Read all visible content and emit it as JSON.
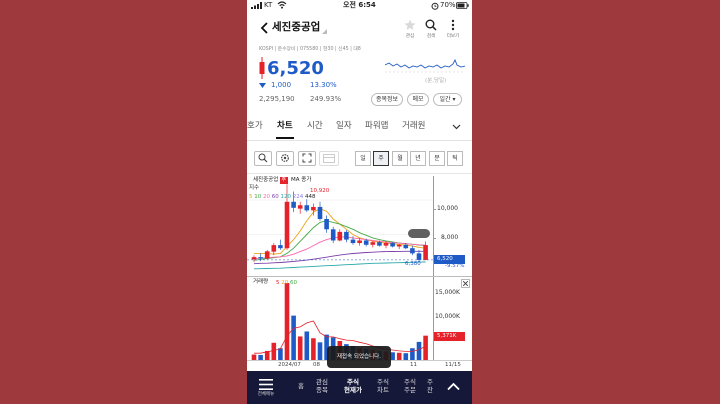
{
  "status": {
    "carrier": "KT",
    "time": "오전 6:54",
    "battery": "70%"
  },
  "header": {
    "stock_name": "세진중공업",
    "actions": [
      {
        "label": "관심",
        "icon": "star-icon"
      },
      {
        "label": "검색",
        "icon": "search-icon"
      },
      {
        "label": "더보기",
        "icon": "more-icon"
      }
    ]
  },
  "quote": {
    "meta": "KOSPI | 운수장비 | 075580 | 현30 | 신45 | 대8",
    "price": "6,520",
    "change": "1,000",
    "change_pct": "13.30%",
    "volume": "2,295,190",
    "turnover_pct": "249.93%",
    "spark_label": "(분,당일)",
    "buttons": [
      "종목정보",
      "메모",
      "일간 ▾"
    ]
  },
  "tabs": [
    "호가",
    "차트",
    "시간",
    "일자",
    "파워맵",
    "거래원"
  ],
  "active_tab": 1,
  "periods": [
    "일",
    "주",
    "월",
    "년",
    "분",
    "틱"
  ],
  "selected_period": 1,
  "chart": {
    "title": "세진중공업",
    "badge": "주",
    "ma_label": "MA 종가",
    "index_label": "지수",
    "ma_periods": [
      "5",
      "10",
      "20",
      "60",
      "120",
      "224",
      "448"
    ],
    "ma_colors": [
      "#e8a317",
      "#44aa44",
      "#ff66aa",
      "#7a3ea8",
      "#2aa8a8",
      "#8877ee",
      "#222222"
    ],
    "max_label": "10,920",
    "min_label": "6,380",
    "min_pct": "-9.57%",
    "price_axis": [
      "10,000",
      "8,000"
    ],
    "current_price_tag": "6,520",
    "volume_title": "거래량",
    "volume_ma": [
      "5",
      "20",
      "60"
    ],
    "volume_axis": [
      "15,000K",
      "10,000K"
    ],
    "volume_tag": "5,371K",
    "x_labels": [
      "2024/07",
      "08",
      "11",
      "11/15"
    ]
  },
  "chart_data": {
    "type": "candlestick",
    "ylim": [
      5700,
      11400
    ],
    "candles": [
      {
        "o": 6550,
        "h": 6780,
        "l": 6380,
        "c": 6680
      },
      {
        "o": 6680,
        "h": 6900,
        "l": 6450,
        "c": 6600
      },
      {
        "o": 6600,
        "h": 7100,
        "l": 6520,
        "c": 7020
      },
      {
        "o": 7000,
        "h": 7500,
        "l": 6800,
        "c": 7380
      },
      {
        "o": 7380,
        "h": 7700,
        "l": 7100,
        "c": 7200
      },
      {
        "o": 7200,
        "h": 10920,
        "l": 7100,
        "c": 9900
      },
      {
        "o": 9900,
        "h": 10500,
        "l": 9300,
        "c": 9550
      },
      {
        "o": 9500,
        "h": 9900,
        "l": 9200,
        "c": 9700
      },
      {
        "o": 9700,
        "h": 10050,
        "l": 9300,
        "c": 9400
      },
      {
        "o": 9400,
        "h": 9800,
        "l": 9100,
        "c": 9600
      },
      {
        "o": 9600,
        "h": 9900,
        "l": 8800,
        "c": 8900
      },
      {
        "o": 8900,
        "h": 9100,
        "l": 8100,
        "c": 8300
      },
      {
        "o": 8300,
        "h": 8450,
        "l": 7500,
        "c": 7650
      },
      {
        "o": 7650,
        "h": 8300,
        "l": 7600,
        "c": 8150
      },
      {
        "o": 8150,
        "h": 8250,
        "l": 7550,
        "c": 7700
      },
      {
        "o": 7700,
        "h": 7900,
        "l": 7400,
        "c": 7500
      },
      {
        "o": 7500,
        "h": 7800,
        "l": 7350,
        "c": 7650
      },
      {
        "o": 7650,
        "h": 7750,
        "l": 7300,
        "c": 7400
      },
      {
        "o": 7400,
        "h": 7600,
        "l": 7250,
        "c": 7550
      },
      {
        "o": 7550,
        "h": 7650,
        "l": 7300,
        "c": 7350
      },
      {
        "o": 7350,
        "h": 7600,
        "l": 7200,
        "c": 7500
      },
      {
        "o": 7500,
        "h": 7550,
        "l": 7250,
        "c": 7300
      },
      {
        "o": 7300,
        "h": 7450,
        "l": 7150,
        "c": 7400
      },
      {
        "o": 7400,
        "h": 7500,
        "l": 7150,
        "c": 7200
      },
      {
        "o": 7200,
        "h": 7350,
        "l": 6800,
        "c": 6900
      },
      {
        "o": 6900,
        "h": 7100,
        "l": 6380,
        "c": 6520
      },
      {
        "o": 6520,
        "h": 7600,
        "l": 6500,
        "c": 7380
      }
    ],
    "ma": [
      [
        6900,
        6900,
        6880,
        6860,
        6900,
        7300,
        7700,
        8200,
        8800,
        9300,
        9500,
        9350,
        8900,
        8600,
        8300,
        8000,
        7800,
        7700,
        7600,
        7550,
        7500,
        7450,
        7420,
        7380,
        7330,
        7250,
        7200
      ],
      [
        6500,
        6550,
        6600,
        6650,
        6700,
        6900,
        7200,
        7600,
        8000,
        8400,
        8700,
        8800,
        8700,
        8600,
        8450,
        8300,
        8100,
        7950,
        7800,
        7700,
        7620,
        7560,
        7500,
        7470,
        7430,
        7380,
        7350
      ],
      [
        6600,
        6620,
        6650,
        6680,
        6700,
        6750,
        6850,
        7000,
        7150,
        7350,
        7550,
        7700,
        7800,
        7850,
        7850,
        7800,
        7750,
        7700,
        7650,
        7600,
        7560,
        7520,
        7490,
        7460,
        7430,
        7400,
        7380
      ],
      [
        6300,
        6320,
        6330,
        6350,
        6370,
        6400,
        6430,
        6470,
        6510,
        6560,
        6620,
        6680,
        6740,
        6800,
        6850,
        6890,
        6920,
        6950,
        6970,
        6990,
        7000,
        7010,
        7015,
        7020,
        7020,
        7020,
        7020
      ],
      [
        6000,
        6010,
        6020,
        6030,
        6040,
        6060,
        6080,
        6100,
        6120,
        6140,
        6160,
        6180,
        6200,
        6220,
        6240,
        6260,
        6280,
        6300,
        6320,
        6330,
        6340,
        6350,
        6360,
        6370,
        6380,
        6390,
        6400
      ]
    ],
    "volume": {
      "ylim": [
        0,
        17000
      ],
      "values": [
        1200,
        1100,
        2000,
        3800,
        2600,
        17000,
        9800,
        5200,
        6300,
        4800,
        3900,
        5600,
        5000,
        4200,
        3500,
        3100,
        2600,
        2400,
        2200,
        2000,
        1900,
        1700,
        1600,
        1500,
        2600,
        4000,
        5371
      ],
      "ma5": [
        1500,
        1500,
        1800,
        2100,
        2500,
        5300,
        7000,
        7300,
        8200,
        8600,
        6000,
        5100,
        5100,
        4700,
        4400,
        4300,
        3900,
        3600,
        3100,
        2700,
        2400,
        2200,
        2000,
        1900,
        1900,
        2300,
        3000
      ]
    }
  },
  "toast": "재접속 되었습니다.",
  "bottom_nav": {
    "menu_label": "전체메뉴",
    "items": [
      {
        "l1": "홈",
        "l2": ""
      },
      {
        "l1": "관심",
        "l2": "종목"
      },
      {
        "l1": "주식",
        "l2": "현재가"
      },
      {
        "l1": "주식",
        "l2": "차트"
      },
      {
        "l1": "주식",
        "l2": "주문"
      },
      {
        "l1": "주",
        "l2": "잔"
      }
    ],
    "active": 2
  }
}
